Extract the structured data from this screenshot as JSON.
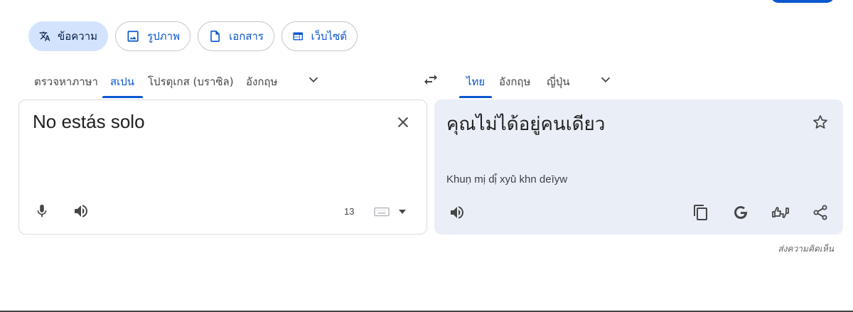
{
  "modes": [
    {
      "label": "ข้อความ",
      "icon": "translate-icon",
      "active": true
    },
    {
      "label": "รูปภาพ",
      "icon": "image-icon",
      "active": false
    },
    {
      "label": "เอกสาร",
      "icon": "document-icon",
      "active": false
    },
    {
      "label": "เว็บไซต์",
      "icon": "website-icon",
      "active": false
    }
  ],
  "source_languages": {
    "items": [
      "ตรวจหาภาษา",
      "สเปน",
      "โปรตุเกส (บราซิล)",
      "อังกฤษ"
    ],
    "selected": "สเปน"
  },
  "target_languages": {
    "items": [
      "ไทย",
      "อังกฤษ",
      "ญี่ปุ่น"
    ],
    "selected": "ไทย"
  },
  "source": {
    "text": "No estás solo",
    "char_count": "13"
  },
  "target": {
    "text": "คุณไม่ได้อยู่คนเดียว",
    "romanization": "Khuṇ mị dị̂ xyū̀ khn deīyw"
  },
  "feedback_label": "ส่งความคิดเห็น",
  "colors": {
    "accent": "#0b57d0",
    "active_chip_bg": "#d3e3fd",
    "target_panel_bg": "#eaeef7"
  },
  "icons": {
    "clear": "close-icon",
    "mic": "microphone-icon",
    "listen": "speaker-icon",
    "keyboard": "keyboard-icon",
    "swap": "swap-languages-icon",
    "star": "star-icon",
    "copy": "copy-icon",
    "google": "google-icon",
    "rate": "rate-translation-icon",
    "share": "share-icon"
  }
}
